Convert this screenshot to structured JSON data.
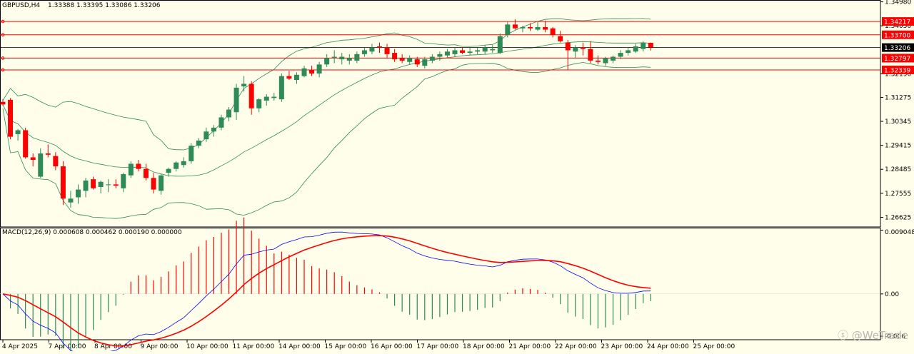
{
  "header": {
    "symbol": "GBPUSD,H4",
    "ohlc": "1.33388 1.33395 1.33086 1.33206",
    "macd_label": "MACD(12,26,9) 0.000608 0.000462 0.000190 0.000000"
  },
  "watermark": "ⓢ @WeTrade",
  "colors": {
    "background": "#fefeea",
    "bull": "#2e8b57",
    "bear": "#ff0000",
    "bands": "#2e8b57",
    "level_line": "#ff0000",
    "price_line": "#000000",
    "macd_line": "#0000ff",
    "signal_line": "#ff0000"
  },
  "chart_data": [
    {
      "type": "candlestick",
      "title": "GBPUSD,H4",
      "y_ticks": [
        "1.34980",
        "1.34050",
        "1.32190",
        "1.31275",
        "1.30345",
        "1.29415",
        "1.28485",
        "1.27555",
        "1.26625"
      ],
      "ylim": [
        1.2625,
        1.3505
      ],
      "x_ticks": [
        "4 Apr 2025",
        "7 Apr 00:00",
        "8 Apr 00:00",
        "9 Apr 00:00",
        "10 Apr 00:00",
        "11 Apr 00:00",
        "14 Apr 00:00",
        "15 Apr 00:00",
        "16 Apr 00:00",
        "17 Apr 00:00",
        "18 Apr 00:00",
        "21 Apr 00:00",
        "22 Apr 00:00",
        "23 Apr 00:00",
        "24 Apr 00:00",
        "25 Apr 00:00"
      ],
      "horizontal_levels": [
        {
          "label": "1.34217",
          "value": 1.34217
        },
        {
          "label": "1.33700",
          "value": 1.337
        },
        {
          "label": "1.32797",
          "value": 1.32797
        },
        {
          "label": "1.32339",
          "value": 1.32339
        }
      ],
      "current_price": {
        "label": "1.33206",
        "value": 1.33206
      },
      "candles": [
        [
          1.311,
          1.312,
          1.3095,
          1.31
        ],
        [
          1.3118,
          1.3125,
          1.2965,
          1.2975
        ],
        [
          1.2985,
          1.3005,
          1.296,
          1.3
        ],
        [
          1.3,
          1.301,
          1.289,
          1.2895
        ],
        [
          1.2895,
          1.291,
          1.286,
          1.2885
        ],
        [
          1.282,
          1.293,
          1.2815,
          1.291
        ],
        [
          1.291,
          1.2945,
          1.2895,
          1.2905
        ],
        [
          1.29,
          1.2915,
          1.2845,
          1.286
        ],
        [
          1.286,
          1.288,
          1.271,
          1.2735
        ],
        [
          1.272,
          1.2765,
          1.27,
          1.2735
        ],
        [
          1.274,
          1.279,
          1.2715,
          1.277
        ],
        [
          1.2765,
          1.2815,
          1.274,
          1.2805
        ],
        [
          1.281,
          1.282,
          1.277,
          1.2775
        ],
        [
          1.278,
          1.2805,
          1.2755,
          1.28
        ],
        [
          1.279,
          1.281,
          1.276,
          1.279
        ],
        [
          1.279,
          1.281,
          1.2775,
          1.2785
        ],
        [
          1.2775,
          1.2835,
          1.276,
          1.283
        ],
        [
          1.2825,
          1.288,
          1.2815,
          1.287
        ],
        [
          1.287,
          1.2885,
          1.284,
          1.285
        ],
        [
          1.285,
          1.287,
          1.2805,
          1.2815
        ],
        [
          1.2815,
          1.2835,
          1.2755,
          1.277
        ],
        [
          1.2765,
          1.283,
          1.275,
          1.2825
        ],
        [
          1.2835,
          1.2855,
          1.282,
          1.285
        ],
        [
          1.285,
          1.288,
          1.284,
          1.2875
        ],
        [
          1.2865,
          1.2895,
          1.2855,
          1.288
        ],
        [
          1.288,
          1.295,
          1.287,
          1.294
        ],
        [
          1.294,
          1.297,
          1.293,
          1.296
        ],
        [
          1.2965,
          1.301,
          1.2955,
          1.2995
        ],
        [
          1.2995,
          1.302,
          1.2975,
          1.301
        ],
        [
          1.301,
          1.306,
          1.3,
          1.305
        ],
        [
          1.305,
          1.309,
          1.3035,
          1.308
        ],
        [
          1.307,
          1.318,
          1.304,
          1.3165
        ],
        [
          1.317,
          1.321,
          1.315,
          1.318
        ],
        [
          1.318,
          1.319,
          1.306,
          1.3085
        ],
        [
          1.3085,
          1.3125,
          1.307,
          1.312
        ],
        [
          1.3115,
          1.314,
          1.3095,
          1.313
        ],
        [
          1.3125,
          1.3145,
          1.3115,
          1.313
        ],
        [
          1.312,
          1.322,
          1.311,
          1.321
        ],
        [
          1.321,
          1.323,
          1.3195,
          1.32
        ],
        [
          1.3195,
          1.3225,
          1.318,
          1.3215
        ],
        [
          1.321,
          1.325,
          1.3205,
          1.324
        ],
        [
          1.3235,
          1.325,
          1.321,
          1.322
        ],
        [
          1.322,
          1.3265,
          1.3205,
          1.3255
        ],
        [
          1.3255,
          1.3295,
          1.3245,
          1.328
        ],
        [
          1.328,
          1.331,
          1.326,
          1.3285
        ],
        [
          1.3275,
          1.33,
          1.3255,
          1.3285
        ],
        [
          1.327,
          1.3295,
          1.3255,
          1.328
        ],
        [
          1.327,
          1.3305,
          1.326,
          1.3295
        ],
        [
          1.3295,
          1.332,
          1.3285,
          1.331
        ],
        [
          1.3305,
          1.3335,
          1.3295,
          1.332
        ],
        [
          1.3325,
          1.334,
          1.33,
          1.332
        ],
        [
          1.332,
          1.3335,
          1.328,
          1.3295
        ],
        [
          1.33,
          1.3315,
          1.3265,
          1.3275
        ],
        [
          1.328,
          1.3295,
          1.326,
          1.327
        ],
        [
          1.3265,
          1.329,
          1.3255,
          1.328
        ],
        [
          1.3275,
          1.3285,
          1.3245,
          1.3255
        ],
        [
          1.325,
          1.3285,
          1.324,
          1.3275
        ],
        [
          1.327,
          1.3295,
          1.326,
          1.3285
        ],
        [
          1.3285,
          1.3305,
          1.327,
          1.3295
        ],
        [
          1.329,
          1.3315,
          1.328,
          1.3305
        ],
        [
          1.3295,
          1.332,
          1.3285,
          1.331
        ],
        [
          1.331,
          1.332,
          1.3295,
          1.33
        ],
        [
          1.33,
          1.332,
          1.329,
          1.3305
        ],
        [
          1.3305,
          1.332,
          1.3295,
          1.331
        ],
        [
          1.3305,
          1.333,
          1.3295,
          1.332
        ],
        [
          1.331,
          1.333,
          1.33,
          1.3315
        ],
        [
          1.33,
          1.3375,
          1.3295,
          1.3365
        ],
        [
          1.337,
          1.342,
          1.336,
          1.341
        ],
        [
          1.341,
          1.343,
          1.339,
          1.3395
        ],
        [
          1.3395,
          1.3405,
          1.338,
          1.34
        ],
        [
          1.34,
          1.3415,
          1.3385,
          1.3395
        ],
        [
          1.339,
          1.342,
          1.3385,
          1.34
        ],
        [
          1.34,
          1.3425,
          1.338,
          1.339
        ],
        [
          1.3395,
          1.34,
          1.336,
          1.337
        ],
        [
          1.3365,
          1.3385,
          1.334,
          1.3345
        ],
        [
          1.334,
          1.335,
          1.3235,
          1.331
        ],
        [
          1.3305,
          1.333,
          1.328,
          1.332
        ],
        [
          1.332,
          1.334,
          1.329,
          1.3315
        ],
        [
          1.3315,
          1.3345,
          1.326,
          1.327
        ],
        [
          1.327,
          1.329,
          1.3255,
          1.3265
        ],
        [
          1.326,
          1.3285,
          1.325,
          1.328
        ],
        [
          1.327,
          1.329,
          1.326,
          1.3285
        ],
        [
          1.3285,
          1.331,
          1.3275,
          1.33
        ],
        [
          1.33,
          1.332,
          1.329,
          1.331
        ],
        [
          1.3305,
          1.3335,
          1.33,
          1.3325
        ],
        [
          1.3315,
          1.3345,
          1.3305,
          1.3338
        ],
        [
          1.3339,
          1.334,
          1.3309,
          1.3321
        ]
      ]
    },
    {
      "type": "line",
      "title": "MACD(12,26,9) 0.000608 0.000462 0.000190 0.000000",
      "y_ticks": [
        "0.009048",
        "0.00",
        "-0.006"
      ],
      "ylim": [
        -0.0065,
        0.0094
      ]
    }
  ]
}
